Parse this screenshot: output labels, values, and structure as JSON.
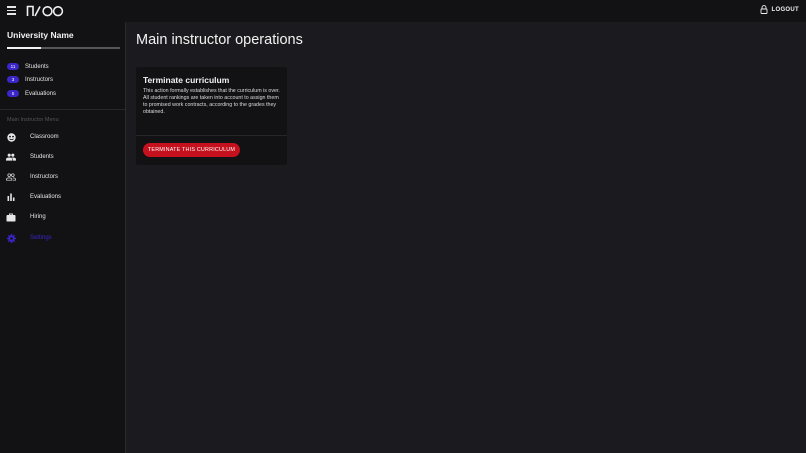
{
  "topbar": {
    "logo_text": "NVOO",
    "logout_label": "LOGOUT"
  },
  "sidebar": {
    "university_name": "University Name",
    "progress_fraction": 0.3,
    "stats": [
      {
        "count": "11",
        "label": "Students"
      },
      {
        "count": "3",
        "label": "Instructors"
      },
      {
        "count": "5",
        "label": "Evaluations"
      }
    ],
    "menu_header": "Main Instructor Menu",
    "items": [
      {
        "label": "Classroom",
        "icon": "classroom-icon"
      },
      {
        "label": "Students",
        "icon": "people-icon"
      },
      {
        "label": "Instructors",
        "icon": "group-outline-icon"
      },
      {
        "label": "Evaluations",
        "icon": "bar-chart-icon"
      },
      {
        "label": "Hiring",
        "icon": "briefcase-icon"
      },
      {
        "label": "Settings",
        "icon": "gear-icon",
        "active": true
      }
    ]
  },
  "main": {
    "title": "Main instructor operations",
    "card": {
      "title": "Terminate curriculum",
      "body": "This action formally establishes that the curriculum is over. All student rankings are taken into account to assign them to promised work contracts, according to the grades they obtained.",
      "button_label": "TERMINATE THIS CURRICULUM"
    }
  },
  "colors": {
    "accent": "#3a25c8",
    "danger": "#c5101d",
    "background": "#1b1b1f",
    "surface": "#121214"
  }
}
